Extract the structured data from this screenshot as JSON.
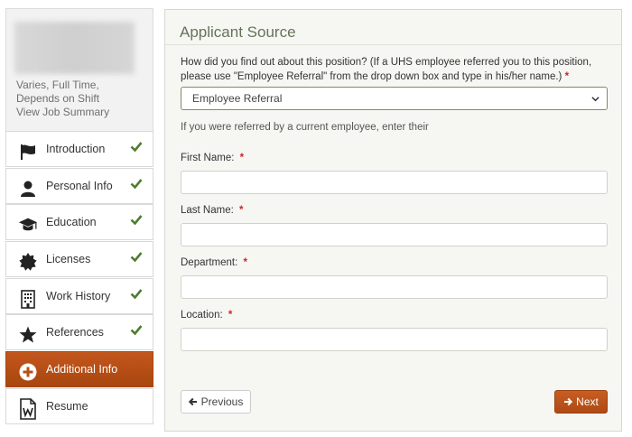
{
  "job": {
    "meta": "Varies, Full Time, Depends on Shift",
    "summary_link": "View Job Summary"
  },
  "nav": {
    "items": [
      {
        "label": "Introduction",
        "icon": "flag-icon",
        "completed": true
      },
      {
        "label": "Personal Info",
        "icon": "person-icon",
        "completed": true
      },
      {
        "label": "Education",
        "icon": "graduation-cap-icon",
        "completed": true
      },
      {
        "label": "Licenses",
        "icon": "badge-certificate-icon",
        "completed": true
      },
      {
        "label": "Work History",
        "icon": "building-icon",
        "completed": true
      },
      {
        "label": "References",
        "icon": "star-icon",
        "completed": true
      },
      {
        "label": "Additional Info",
        "icon": "plus-circle-icon",
        "active": true
      },
      {
        "label": "Resume",
        "icon": "word-document-icon",
        "completed": false
      }
    ],
    "check_color": "#4e7d2f",
    "active_color": "#b8501a"
  },
  "form": {
    "title": "Applicant Source",
    "question": "How did you find out about this position? (If a UHS employee referred you to this position, please use \"Employee Referral\" from the drop down box and type in his/her name.)",
    "required_mark": "*",
    "source_value": "Employee Referral",
    "hint": "If you were referred by a current employee, enter their",
    "fields": {
      "first_name": {
        "label": "First Name:",
        "value": ""
      },
      "last_name": {
        "label": "Last Name:",
        "value": ""
      },
      "department": {
        "label": "Department:",
        "value": ""
      },
      "location": {
        "label": "Location:",
        "value": ""
      }
    },
    "prev_label": "Previous",
    "next_label": "Next"
  }
}
